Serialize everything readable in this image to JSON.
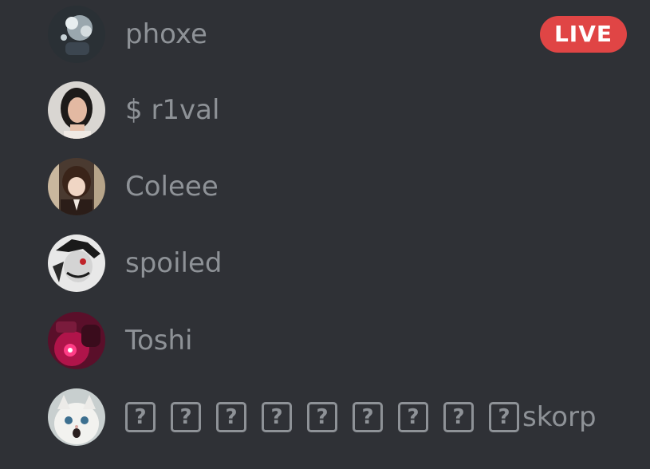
{
  "members": [
    {
      "name": "phoxe",
      "avatar": "avatar-phoxe",
      "badge": "LIVE"
    },
    {
      "name": "$ r1val",
      "avatar": "avatar-r1val"
    },
    {
      "name": "Coleee",
      "avatar": "avatar-coleee"
    },
    {
      "name": "spoiled",
      "avatar": "avatar-spoiled"
    },
    {
      "name": "Toshi",
      "avatar": "avatar-toshi"
    },
    {
      "name_glyphs": [
        "?",
        "?",
        "?",
        "?",
        "?",
        "?",
        "?",
        "?",
        "?"
      ],
      "name_suffix": "skorp",
      "avatar": "avatar-skorp"
    }
  ],
  "colors": {
    "background": "#2f3136",
    "name_text": "#8e9297",
    "live_badge": "#e04545"
  }
}
